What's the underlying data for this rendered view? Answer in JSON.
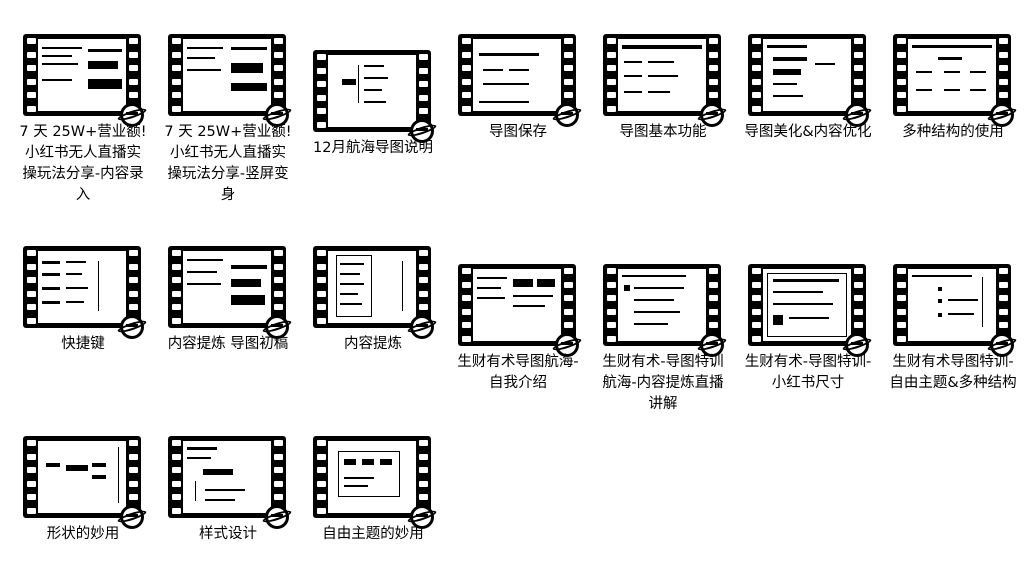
{
  "items": [
    {
      "label": "7 天 25W+营业额!小红书无人直播实操玩法分享-内容录入"
    },
    {
      "label": "7 天 25W+营业额!小红书无人直播实操玩法分享-竖屏变身"
    },
    {
      "label": "12月航海导图说明"
    },
    {
      "label": "导图保存"
    },
    {
      "label": "导图基本功能"
    },
    {
      "label": "导图美化&内容优化"
    },
    {
      "label": "多种结构的使用"
    },
    {
      "label": "快捷键"
    },
    {
      "label": "内容提炼 导图初稿"
    },
    {
      "label": "内容提炼"
    },
    {
      "label": "生财有术导图航海-自我介绍"
    },
    {
      "label": "生财有术-导图特训航海-内容提炼直播讲解"
    },
    {
      "label": "生财有术-导图特训-小红书尺寸"
    },
    {
      "label": "生财有术导图特训-自由主题&多种结构"
    },
    {
      "label": "形状的妙用"
    },
    {
      "label": "样式设计"
    },
    {
      "label": "自由主题的妙用"
    }
  ]
}
